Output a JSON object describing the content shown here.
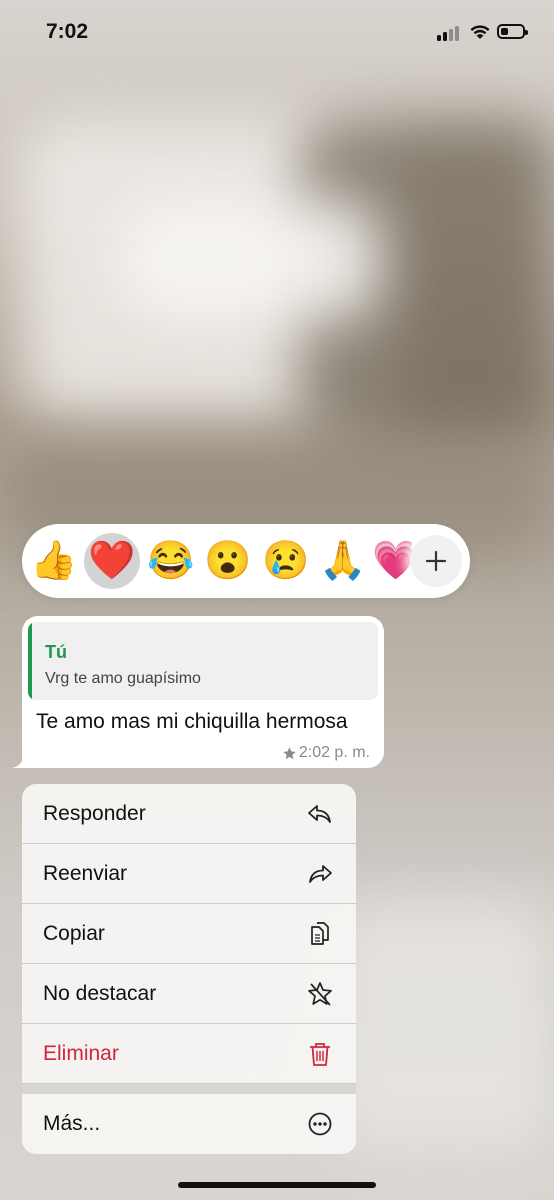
{
  "status_bar": {
    "time": "7:02"
  },
  "reactions": {
    "emojis": [
      "👍",
      "❤️",
      "😂",
      "😮",
      "😢",
      "🙏",
      "💗"
    ],
    "selected_index": 1
  },
  "message": {
    "quote_author": "Tú",
    "quote_text": "Vrg te amo guapísimo",
    "text": "Te amo mas mi chiquilla hermosa",
    "time": "2:02 p. m.",
    "starred": true
  },
  "menu": {
    "items": [
      {
        "label": "Responder",
        "icon": "reply-icon"
      },
      {
        "label": "Reenviar",
        "icon": "forward-icon"
      },
      {
        "label": "Copiar",
        "icon": "copy-icon"
      },
      {
        "label": "No destacar",
        "icon": "unstar-icon"
      },
      {
        "label": "Eliminar",
        "icon": "trash-icon"
      },
      {
        "label": "Más...",
        "icon": "more-icon"
      }
    ]
  },
  "colors": {
    "accent_green": "#1f9950",
    "danger_red": "#d0263e"
  }
}
